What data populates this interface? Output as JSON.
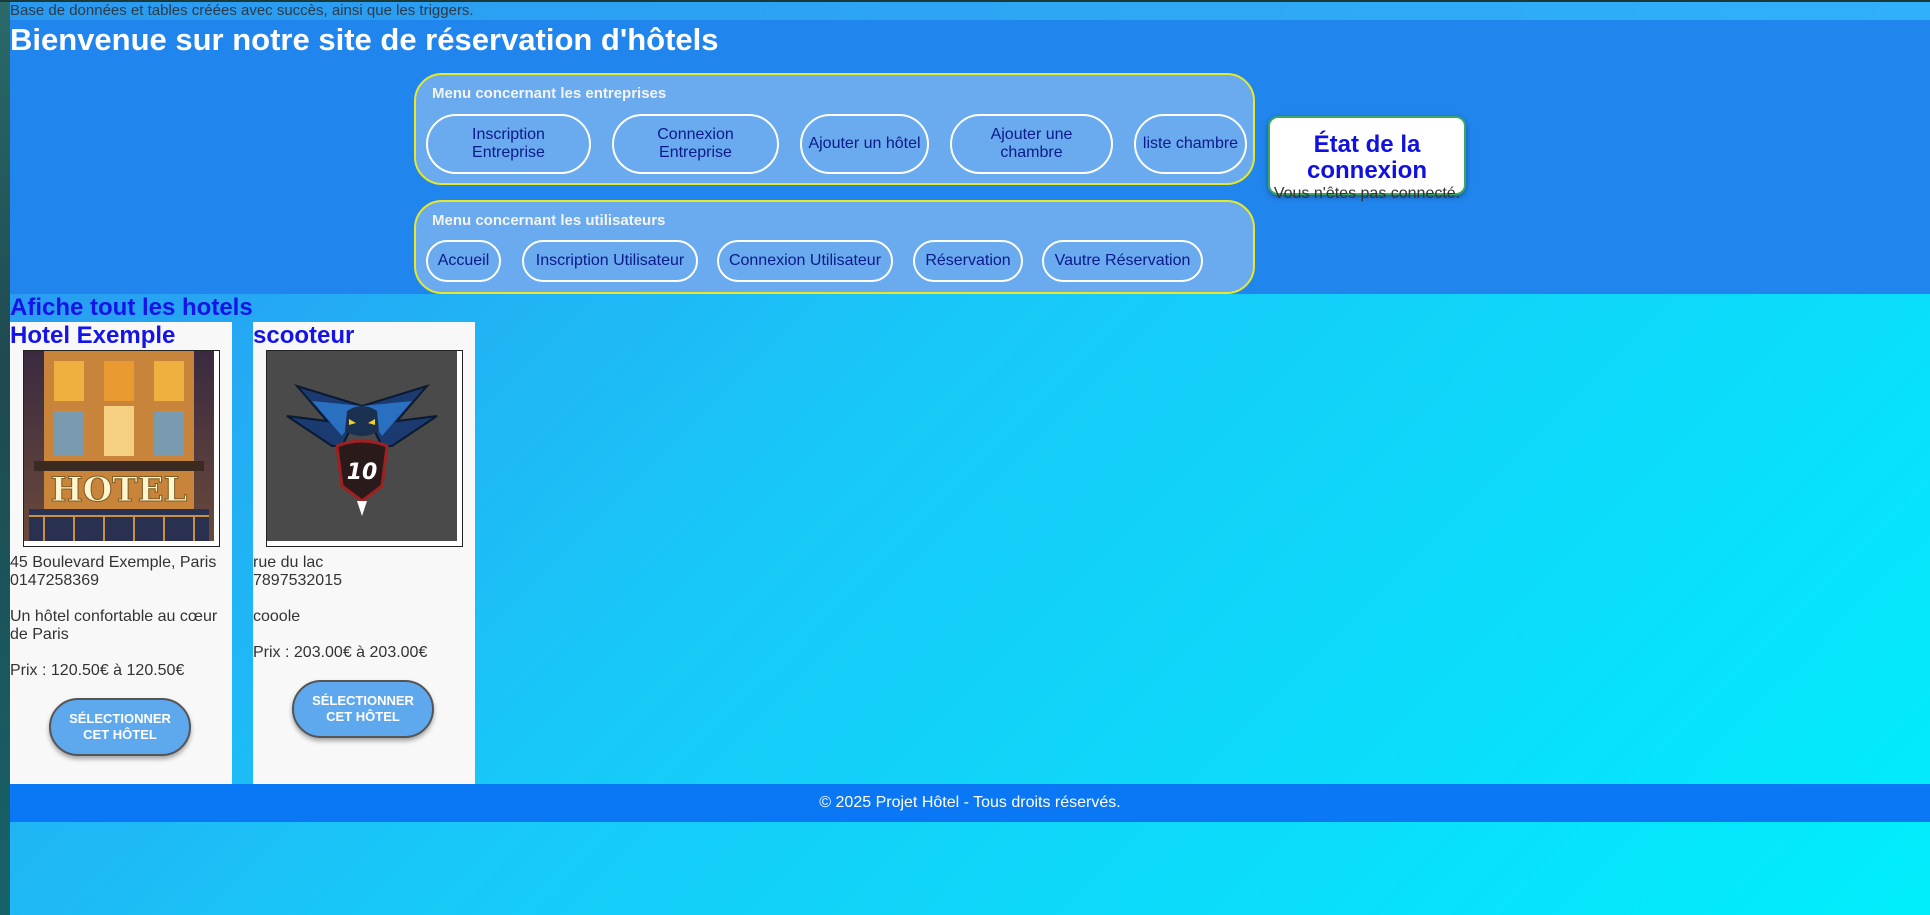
{
  "status_message": "Base de données et tables créées avec succès, ainsi que les triggers.",
  "header": {
    "title": "Bienvenue sur notre site de réservation d'hôtels"
  },
  "menu_entreprises": {
    "title": "Menu concernant les entreprises",
    "items": [
      "Inscription Entreprise",
      "Connexion Entreprise",
      "Ajouter un hôtel",
      "Ajouter une chambre",
      "liste chambre"
    ]
  },
  "menu_utilisateurs": {
    "title": "Menu concernant les utilisateurs",
    "items": [
      "Accueil",
      "Inscription Utilisateur",
      "Connexion Utilisateur",
      "Réservation",
      "Vautre Réservation"
    ]
  },
  "connection_state": {
    "title": "État de la connexion",
    "text": "Vous n'êtes pas connecté."
  },
  "listing_title": "Afiche tout les hotels",
  "hotels": [
    {
      "name": "Hotel Exemple",
      "image": "hotel-facade-photo",
      "address": "45 Boulevard Exemple, Paris",
      "phone": "0147258369",
      "description": "Un hôtel confortable au cœur de Paris",
      "price": "Prix : 120.50€ à 120.50€",
      "button": "Sélectionner cet hôtel",
      "photo_sign": "HOTEL"
    },
    {
      "name": "scooteur",
      "image": "bird-logo-image",
      "address": "rue du lac",
      "phone": "7897532015",
      "description": "cooole",
      "price": "Prix : 203.00€ à 203.00€",
      "button": "Sélectionner cet hôtel",
      "logo_number": "10"
    }
  ],
  "footer": {
    "text": "© 2025 Projet Hôtel - Tous droits réservés."
  },
  "colors": {
    "header_bg": "#2185ee",
    "menu_bg": "#6aaaee",
    "menu_border": "#e8e82a",
    "title_blue": "#1414e8",
    "footer_bg": "#0a78f5"
  }
}
